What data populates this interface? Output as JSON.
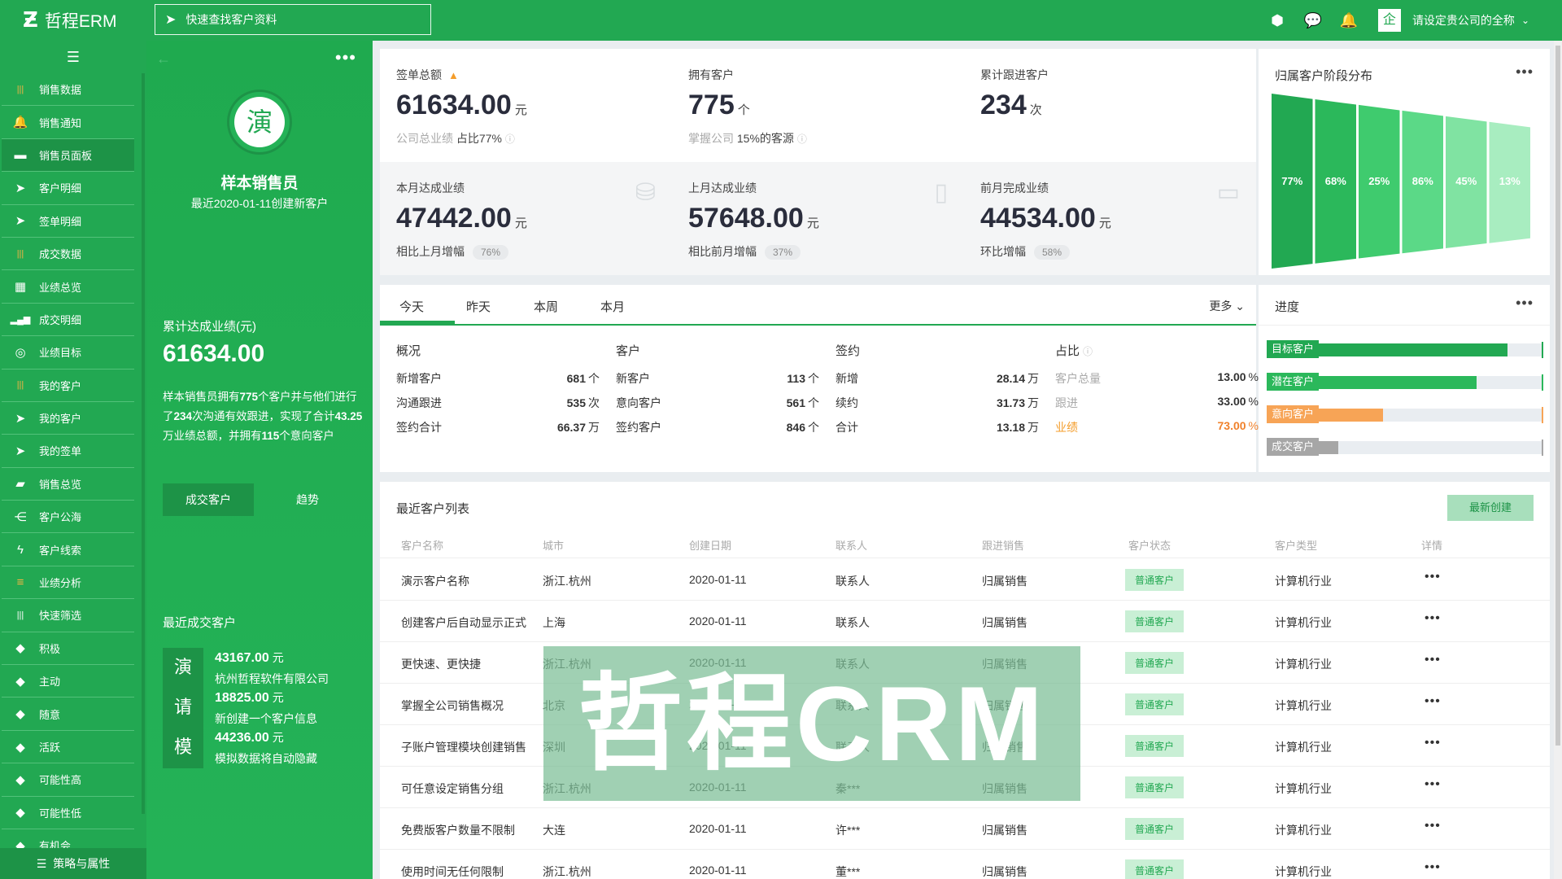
{
  "header": {
    "brand": "哲程ERM",
    "search_placeholder": "快速查找客户资料",
    "company": "请设定贵公司的全称",
    "company_badge": "企"
  },
  "nav": {
    "items": [
      {
        "label": "销售数据",
        "icon": "bars-icon",
        "orange": true
      },
      {
        "label": "销售通知",
        "icon": "bell-icon"
      },
      {
        "label": "销售员面板",
        "icon": "dashboard-icon",
        "active": true
      },
      {
        "label": "客户明细",
        "icon": "send-icon"
      },
      {
        "label": "签单明细",
        "icon": "send-icon"
      },
      {
        "label": "成交数据",
        "icon": "bars-icon",
        "orange": true
      },
      {
        "label": "业绩总览",
        "icon": "grid-icon"
      },
      {
        "label": "成交明细",
        "icon": "signal-icon"
      },
      {
        "label": "业绩目标",
        "icon": "target-icon"
      },
      {
        "label": "我的客户",
        "icon": "bars-icon",
        "orange": true
      },
      {
        "label": "我的客户",
        "icon": "send-icon"
      },
      {
        "label": "我的签单",
        "icon": "send-icon"
      },
      {
        "label": "销售总览",
        "icon": "folder-icon"
      },
      {
        "label": "客户公海",
        "icon": "share-icon"
      },
      {
        "label": "客户线索",
        "icon": "bolt-icon"
      },
      {
        "label": "业绩分析",
        "icon": "menu-icon",
        "orange": true
      },
      {
        "label": "快速筛选",
        "icon": "bars-icon"
      },
      {
        "label": "积极",
        "icon": "tag-icon"
      },
      {
        "label": "主动",
        "icon": "tag-icon"
      },
      {
        "label": "随意",
        "icon": "tag-icon"
      },
      {
        "label": "活跃",
        "icon": "tag-icon"
      },
      {
        "label": "可能性高",
        "icon": "tag-icon"
      },
      {
        "label": "可能性低",
        "icon": "tag-icon"
      },
      {
        "label": "有机会",
        "icon": "tag-icon"
      }
    ],
    "bottom": "策略与属性"
  },
  "profile": {
    "avatar": "演",
    "name": "样本销售员",
    "subtitle": "最近2020-01-11创建新客户",
    "total_label": "累计达成业绩(元)",
    "total_value": "61634.00",
    "desc_parts": [
      "样本销售员拥有",
      "775",
      "个客户并与他们进行了",
      "234",
      "次沟通有效跟进，实现了合计",
      "43.25",
      "万业绩总额，并拥有",
      "115",
      "个意向客户"
    ],
    "tab_a": "成交客户",
    "tab_b": "趋势",
    "recent_label": "最近成交客户",
    "deals": [
      {
        "icon": "演",
        "amount": "43167.00",
        "unit": "元",
        "name": "杭州哲程软件有限公司"
      },
      {
        "icon": "请",
        "amount": "18825.00",
        "unit": "元",
        "name": "新创建一个客户信息"
      },
      {
        "icon": "模",
        "amount": "44236.00",
        "unit": "元",
        "name": "模拟数据将自动隐藏"
      }
    ]
  },
  "stats": {
    "s1": {
      "label": "签单总额",
      "value": "61634.00",
      "unit": "元",
      "sub_muted": "公司总业绩",
      "sub": "占比77%"
    },
    "s2": {
      "label": "拥有客户",
      "value": "775",
      "unit": "个",
      "sub_muted": "掌握公司",
      "sub": "15%的客源"
    },
    "s3": {
      "label": "累计跟进客户",
      "value": "234",
      "unit": "次"
    },
    "s4": {
      "label": "本月达成业绩",
      "value": "47442.00",
      "unit": "元",
      "sub": "相比上月增幅",
      "pill": "76%"
    },
    "s5": {
      "label": "上月达成业绩",
      "value": "57648.00",
      "unit": "元",
      "sub": "相比前月增幅",
      "pill": "37%"
    },
    "s6": {
      "label": "前月完成业绩",
      "value": "44534.00",
      "unit": "元",
      "sub": "环比增幅",
      "pill": "58%"
    }
  },
  "funnel": {
    "title": "归属客户阶段分布",
    "stages": [
      {
        "label": "77%",
        "color": "#22a852"
      },
      {
        "label": "68%",
        "color": "#2bb85b"
      },
      {
        "label": "25%",
        "color": "#3fcb6e"
      },
      {
        "label": "86%",
        "color": "#5bd987"
      },
      {
        "label": "45%",
        "color": "#80e3a2"
      },
      {
        "label": "13%",
        "color": "#a8edc0"
      }
    ]
  },
  "today": {
    "tabs": [
      "今天",
      "昨天",
      "本周",
      "本月"
    ],
    "more": "更多",
    "groups": [
      {
        "title": "概况",
        "rows": [
          {
            "label": "新增客户",
            "value": "681",
            "unit": "个"
          },
          {
            "label": "沟通跟进",
            "value": "535",
            "unit": "次"
          },
          {
            "label": "签约合计",
            "value": "66.37",
            "unit": "万"
          }
        ]
      },
      {
        "title": "客户",
        "rows": [
          {
            "label": "新客户",
            "value": "113",
            "unit": "个"
          },
          {
            "label": "意向客户",
            "value": "561",
            "unit": "个"
          },
          {
            "label": "签约客户",
            "value": "846",
            "unit": "个"
          }
        ]
      },
      {
        "title": "签约",
        "rows": [
          {
            "label": "新增",
            "value": "28.14",
            "unit": "万"
          },
          {
            "label": "续约",
            "value": "31.73",
            "unit": "万"
          },
          {
            "label": "合计",
            "value": "13.18",
            "unit": "万"
          }
        ]
      },
      {
        "title": "占比",
        "rows": [
          {
            "label": "客户总量",
            "value": "13.00",
            "unit": "%"
          },
          {
            "label": "跟进",
            "value": "33.00",
            "unit": "%"
          },
          {
            "label": "业绩",
            "value": "73.00",
            "unit": "%"
          }
        ]
      }
    ]
  },
  "progress": {
    "title": "进度",
    "bars": [
      {
        "label": "目标客户",
        "fraction": 0.87,
        "color": "#22a852"
      },
      {
        "label": "潜在客户",
        "fraction": 0.76,
        "color": "#2bb85b"
      },
      {
        "label": "意向客户",
        "fraction": 0.42,
        "color": "#f7a456"
      },
      {
        "label": "成交客户",
        "fraction": 0.26,
        "color": "#a6a6a6"
      }
    ]
  },
  "list": {
    "title": "最近客户列表",
    "new_button": "最新创建",
    "columns": [
      "客户名称",
      "城市",
      "创建日期",
      "联系人",
      "跟进销售",
      "客户状态",
      "客户类型",
      "详情"
    ],
    "rows": [
      [
        "演示客户名称",
        "浙江.杭州",
        "2020-01-11",
        "联系人",
        "归属销售",
        "普通客户",
        "计算机行业"
      ],
      [
        "创建客户后自动显示正式",
        "上海",
        "2020-01-11",
        "联系人",
        "归属销售",
        "普通客户",
        "计算机行业"
      ],
      [
        "更快速、更快捷",
        "浙江.杭州",
        "2020-01-11",
        "联系人",
        "归属销售",
        "普通客户",
        "计算机行业"
      ],
      [
        "掌握全公司销售概况",
        "北京",
        "2020-01-11",
        "联系人",
        "归属销售",
        "普通客户",
        "计算机行业"
      ],
      [
        "子账户管理模块创建销售",
        "深圳",
        "2020-01-11",
        "联系人",
        "归属销售",
        "普通客户",
        "计算机行业"
      ],
      [
        "可任意设定销售分组",
        "浙江.杭州",
        "2020-01-11",
        "秦***",
        "归属销售",
        "普通客户",
        "计算机行业"
      ],
      [
        "免费版客户数量不限制",
        "大连",
        "2020-01-11",
        "许***",
        "归属销售",
        "普通客户",
        "计算机行业"
      ],
      [
        "使用时间无任何限制",
        "浙江.杭州",
        "2020-01-11",
        "董***",
        "归属销售",
        "普通客户",
        "计算机行业"
      ]
    ]
  },
  "watermark": "哲程CRM"
}
